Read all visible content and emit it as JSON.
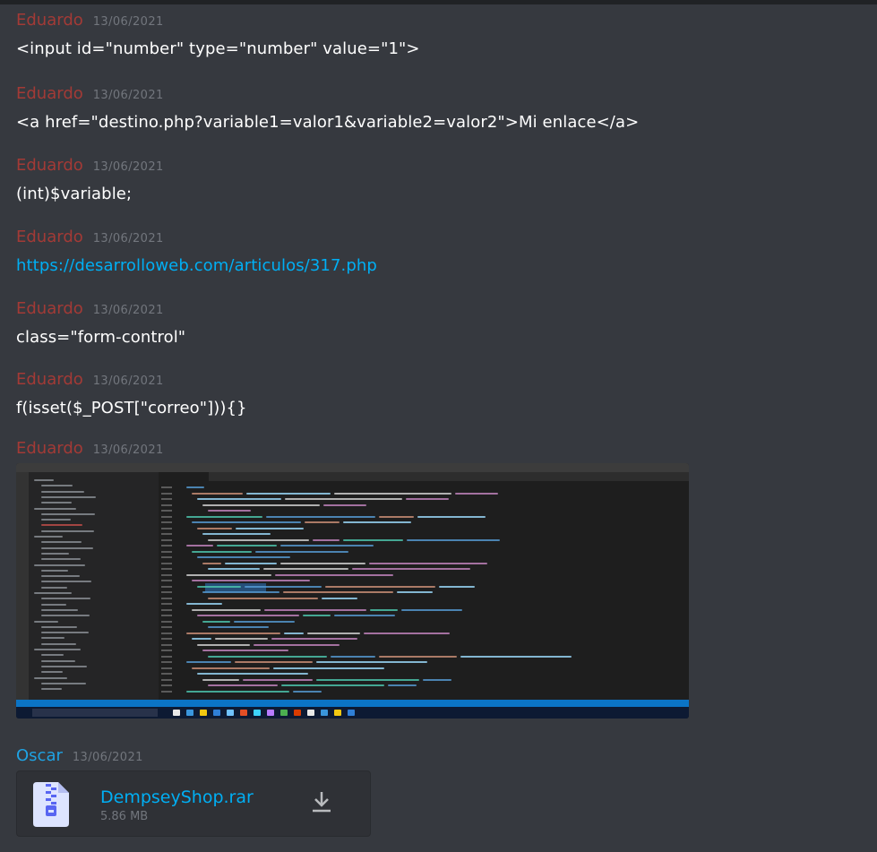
{
  "colors": {
    "eduardo": "#a33a36",
    "oscar": "#1fa3e3",
    "link": "#00aff4",
    "timestamp": "#72767d"
  },
  "messages": [
    {
      "author": "Eduardo",
      "time": "13/06/2021",
      "text": "<input id=\"number\" type=\"number\" value=\"1\">"
    },
    {
      "author": "Eduardo",
      "time": "13/06/2021",
      "text": "<a href=\"destino.php?variable1=valor1&variable2=valor2\">Mi enlace</a>"
    },
    {
      "author": "Eduardo",
      "time": "13/06/2021",
      "text": "(int)$variable;"
    },
    {
      "author": "Eduardo",
      "time": "13/06/2021",
      "link": "https://desarrolloweb.com/articulos/317.php"
    },
    {
      "author": "Eduardo",
      "time": "13/06/2021",
      "text": "class=\"form-control\""
    },
    {
      "author": "Eduardo",
      "time": "13/06/2021",
      "text": "f(isset($_POST[\"correo\"])){}"
    },
    {
      "author": "Eduardo",
      "time": "13/06/2021"
    },
    {
      "author": "Oscar",
      "time": "13/06/2021",
      "file": {
        "name": "DempseyShop.rar",
        "size": "5.86 MB"
      }
    }
  ],
  "icons": {
    "file": "zip-file-icon",
    "download": "download-icon"
  }
}
